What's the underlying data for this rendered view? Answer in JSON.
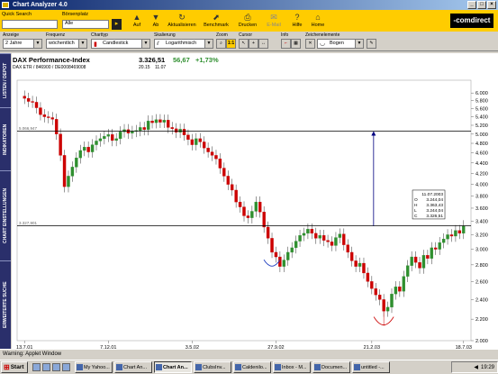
{
  "window": {
    "title": "Chart Analyzer 4.0",
    "buttons": [
      "_",
      "□",
      "×"
    ]
  },
  "toolbar": {
    "quick_search_label": "Quick Search",
    "boersenplatz_label": "Börsenplatz",
    "boersenplatz_value": "Alle",
    "buttons": [
      {
        "label": "Auf",
        "icon": "arrow-up-icon",
        "glyph": "▲"
      },
      {
        "label": "Ab",
        "icon": "arrow-down-icon",
        "glyph": "▼"
      },
      {
        "label": "Aktualisieren",
        "icon": "refresh-icon",
        "glyph": "↻"
      },
      {
        "label": "Benchmark",
        "icon": "benchmark-icon",
        "glyph": "⬈"
      },
      {
        "label": "Drucken",
        "icon": "printer-icon",
        "glyph": "⎙"
      },
      {
        "label": "E-Mail",
        "icon": "mail-icon",
        "glyph": "✉"
      },
      {
        "label": "Hilfe",
        "icon": "help-icon",
        "glyph": "?"
      },
      {
        "label": "Home",
        "icon": "home-icon",
        "glyph": "⌂"
      }
    ],
    "brand": "-comdirect"
  },
  "options": {
    "anzeige": {
      "label": "Anzeige",
      "value": "2 Jahre"
    },
    "frequenz": {
      "label": "Frequenz",
      "value": "wöchentlich"
    },
    "charttyp": {
      "label": "Charttyp",
      "value": "Candlestick"
    },
    "skalierung": {
      "label": "Skalierung",
      "value": "Logarithmisch"
    },
    "zoom": {
      "label": "Zoom",
      "value": "1:1"
    },
    "cursor": {
      "label": "Cursor"
    },
    "info": {
      "label": "Info"
    },
    "zeichenelemente": {
      "label": "Zeichenelemente",
      "value": "Bogen"
    }
  },
  "sidebar": {
    "items": [
      "LISTEN / DEPOT",
      "INDIKATOREN",
      "CHART EINSTELLUNGEN",
      "ERWEITERTE SUCHE"
    ]
  },
  "chart_header": {
    "name": "DAX Performance-Index",
    "price": "3.326,51",
    "change": "56,67",
    "change_pct": "+1,73%",
    "sub": "DAX ETR / 846900 / DE0008469008",
    "time": "20.15",
    "date": "11.07"
  },
  "colors": {
    "up": "#2f8f2f",
    "down": "#cc0000",
    "brand": "#ffcc00",
    "sidebar": "#2a2f6b",
    "hline": "#000080"
  },
  "chart_data": {
    "type": "candlestick",
    "y_scale": "log",
    "ylim": [
      2000,
      6200
    ],
    "y_ticks": [
      "6.000",
      "5.800",
      "5.600",
      "5.400",
      "5.200",
      "5.000",
      "4.800",
      "4.600",
      "4.400",
      "4.200",
      "4.000",
      "3.800",
      "3.600",
      "3.400",
      "3.200",
      "3.000",
      "2.800",
      "2.600",
      "2.400",
      "2.200",
      "2.000"
    ],
    "x_ticks": [
      "13.7.01",
      "7.12.01",
      "3.5.02",
      "27.9.02",
      "21.2.03",
      "18.7.03"
    ],
    "hlines": [
      {
        "label": "5.066,947",
        "value": 5066.947
      },
      {
        "label": "3.327,901",
        "value": 3327.901
      }
    ],
    "closes": [
      5860,
      5780,
      5760,
      5620,
      5450,
      5400,
      5380,
      5340,
      5000,
      4550,
      3960,
      4150,
      4320,
      4500,
      4650,
      4720,
      4620,
      4770,
      4850,
      4900,
      4950,
      4990,
      4860,
      4900,
      5050,
      5100,
      5020,
      5060,
      5080,
      5150,
      5100,
      5300,
      5260,
      5330,
      5270,
      5320,
      5150,
      5120,
      5040,
      5110,
      4980,
      4880,
      4770,
      4900,
      4830,
      4700,
      4620,
      4550,
      4480,
      4300,
      4150,
      4000,
      3900,
      3700,
      3620,
      3480,
      3450,
      3550,
      3700,
      3540,
      3310,
      3150,
      2960,
      2900,
      2780,
      2860,
      2960,
      3020,
      3110,
      3190,
      3220,
      3280,
      3220,
      3150,
      3190,
      3120,
      3100,
      3050,
      3160,
      3210,
      3060,
      2960,
      2850,
      2780,
      2820,
      2700,
      2600,
      2520,
      2450,
      2400,
      2280,
      2320,
      2460,
      2540,
      2490,
      2660,
      2790,
      2900,
      2830,
      2760,
      2920,
      2880,
      3020,
      3000,
      3090,
      3140,
      3200,
      3180,
      3260,
      3220,
      3330
    ],
    "info_box": {
      "date": "11.07.2003",
      "O": "3.244,04",
      "H": "3.363,43",
      "L": "3.244,04",
      "C": "3.326,51"
    }
  },
  "status": {
    "text": "Warning: Applet Window"
  },
  "taskbar": {
    "start": "Start",
    "tasks": [
      "My Yahoo...",
      "Chart An...",
      "Chart An...",
      "ClubsInv...",
      "Caldenilo...",
      "Inbox - M...",
      "Documen...",
      "untitled -..."
    ],
    "clock": "19:29"
  }
}
